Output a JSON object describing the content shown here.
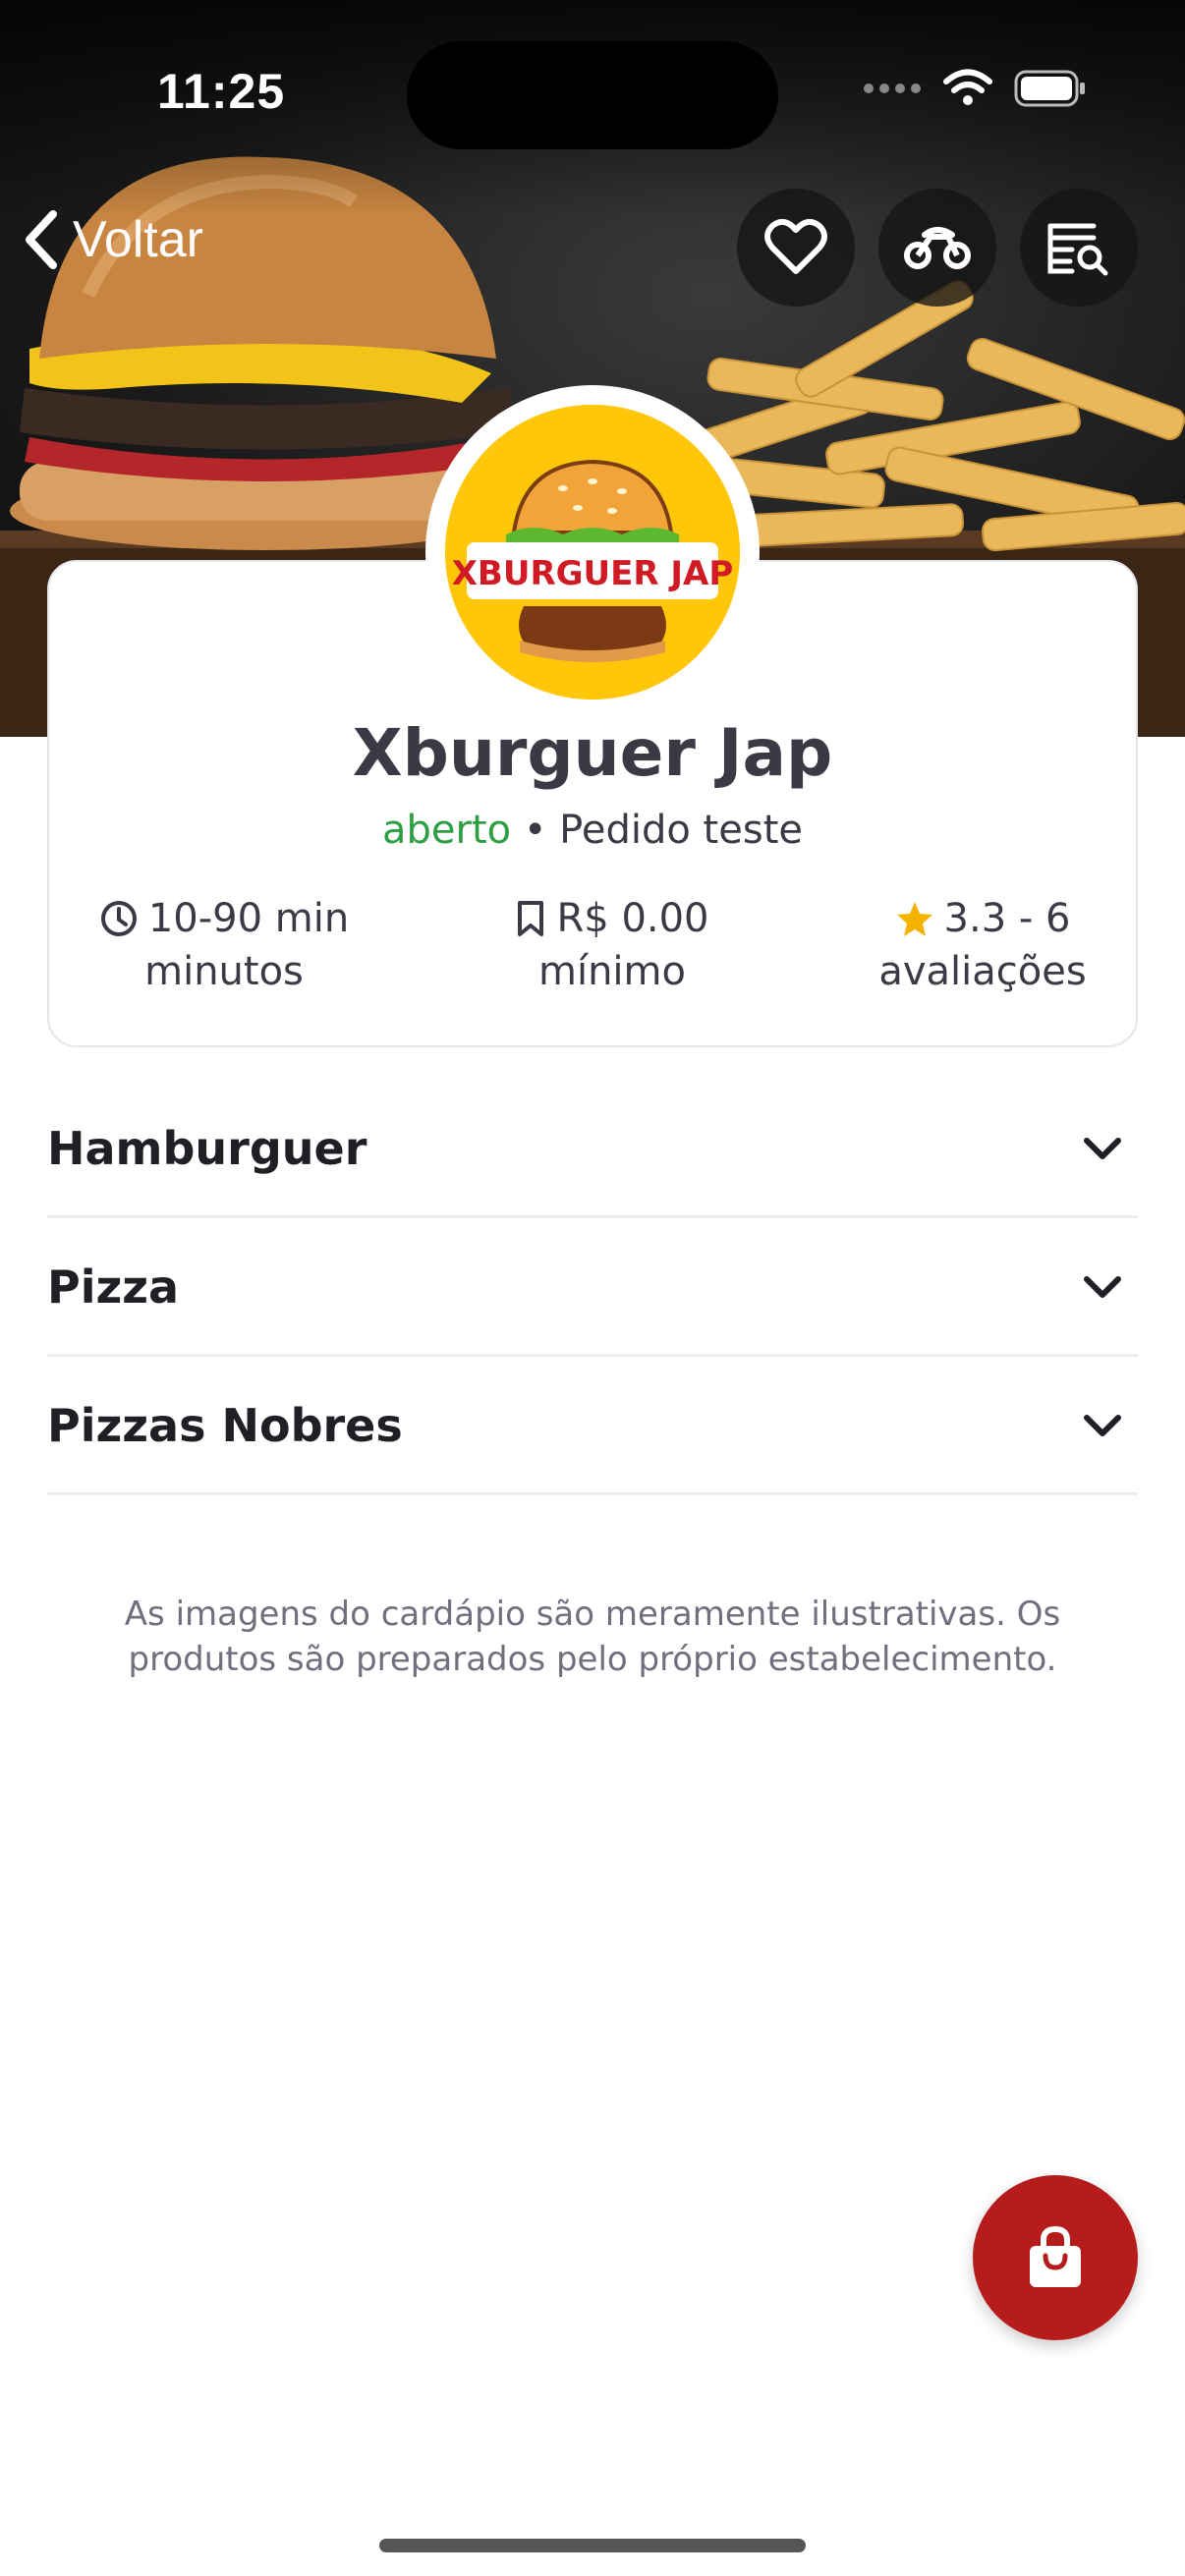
{
  "status_bar": {
    "time": "11:25"
  },
  "nav": {
    "back_label": "Voltar"
  },
  "colors": {
    "accent_red": "#b71c1c",
    "open_green": "#2ea043",
    "logo_yellow": "#ffc60a",
    "star": "#f5b301"
  },
  "store": {
    "name": "Xburguer Jap",
    "logo_text": "XBURGUER JAP",
    "status_open": "aberto",
    "status_separator": "•",
    "status_note": "Pedido teste",
    "delivery_time": "10-90 min",
    "delivery_time_unit": "minutos",
    "minimum": "R$ 0.00",
    "minimum_label": "mínimo",
    "rating": "3.3 - 6",
    "rating_label": "avaliações"
  },
  "categories": [
    {
      "label": "Hamburguer"
    },
    {
      "label": "Pizza"
    },
    {
      "label": "Pizzas Nobres"
    }
  ],
  "disclaimer": {
    "line1": "As imagens do cardápio são meramente ilustrativas. Os",
    "line2": "produtos são preparados pelo próprio estabelecimento."
  },
  "icons": [
    "chevron-left-icon",
    "heart-icon",
    "motorcycle-icon",
    "menu-search-icon",
    "clock-icon",
    "bookmark-icon",
    "star-icon",
    "chevron-down-icon",
    "shopping-bag-icon"
  ]
}
